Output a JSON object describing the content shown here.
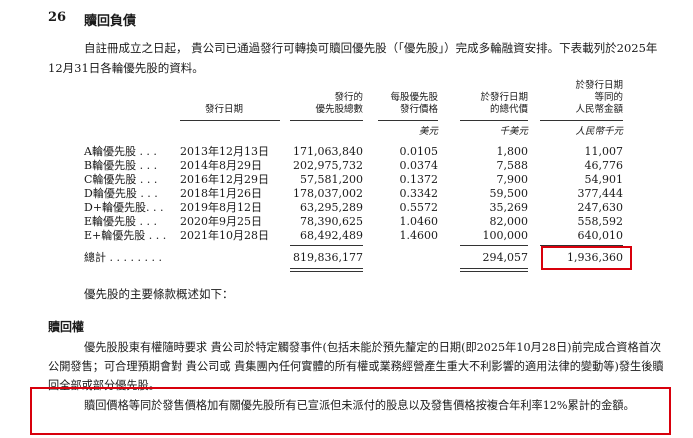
{
  "section": {
    "number": "26",
    "title": "贖回負債"
  },
  "intro": "自註冊成立之日起， 貴公司已通過發行可轉換可贖回優先股（「優先股」）完成多輪融資安排。下表載列於2025年12月31日各輪優先股的資料。",
  "table": {
    "headers": {
      "issue_date": "發行日期",
      "total_shares": "發行的\n優先股總數",
      "price_per_share": "每股優先股\n發行價格",
      "total_usd": "於發行日期\n的總代價",
      "total_rmb": "於發行日期\n等同的\n人民幣金額"
    },
    "units": {
      "price_per_share": "美元",
      "total_usd": "千美元",
      "total_rmb": "人民幣千元"
    },
    "rows": [
      {
        "name": "A輪優先股 . . .",
        "date": "2013年12月13日",
        "shares": "171,063,840",
        "price": "0.0105",
        "usd": "1,800",
        "rmb": "11,007"
      },
      {
        "name": "B輪優先股 . . .",
        "date": "2014年8月29日",
        "shares": "202,975,732",
        "price": "0.0374",
        "usd": "7,588",
        "rmb": "46,776"
      },
      {
        "name": "C輪優先股 . . .",
        "date": "2016年12月29日",
        "shares": "57,581,200",
        "price": "0.1372",
        "usd": "7,900",
        "rmb": "54,901"
      },
      {
        "name": "D輪優先股 . . .",
        "date": "2018年1月26日",
        "shares": "178,037,002",
        "price": "0.3342",
        "usd": "59,500",
        "rmb": "377,444"
      },
      {
        "name": "D+輪優先股. . .",
        "date": "2019年8月12日",
        "shares": "63,295,289",
        "price": "0.5572",
        "usd": "35,269",
        "rmb": "247,630"
      },
      {
        "name": "E輪優先股 . . .",
        "date": "2020年9月25日",
        "shares": "78,390,625",
        "price": "1.0460",
        "usd": "82,000",
        "rmb": "558,592"
      },
      {
        "name": "E+輪優先股 . . .",
        "date": "2021年10月28日",
        "shares": "68,492,489",
        "price": "1.4600",
        "usd": "100,000",
        "rmb": "640,010"
      }
    ],
    "total": {
      "label": "總計 . . . . . . . .",
      "shares": "819,836,177",
      "usd": "294,057",
      "rmb": "1,936,360"
    }
  },
  "summary_intro": "優先股的主要條款概述如下：",
  "redemption": {
    "heading": "贖回權",
    "paragraph": "優先股股東有權隨時要求 貴公司於特定觸發事件(包括未能於預先釐定的日期(即2025年10月28日)前完成合資格首次公開發售；可合理預期會對 貴公司或 貴集團內任何實體的所有權或業務經營產生重大不利影響的適用法律的變動等)發生後贖回全部或部分優先股。",
    "price_paragraph": "贖回價格等同於發售價格加有關優先股所有已宣派但未派付的股息以及發售價格按複合年利率12%累計的金額。"
  },
  "highlight_color": "#d8000c"
}
